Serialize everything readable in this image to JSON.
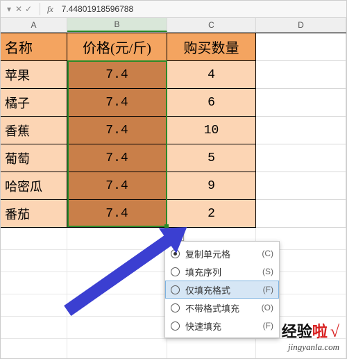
{
  "formula_bar": {
    "fx_label": "fx",
    "value": "7.44801918596788"
  },
  "col_headers": {
    "A": "A",
    "B": "B",
    "C": "C",
    "D": "D"
  },
  "table": {
    "headers": {
      "name": "名称",
      "price": "价格(元/斤)",
      "qty": "购买数量"
    },
    "rows": [
      {
        "name": "苹果",
        "price": "7.4",
        "qty": "4"
      },
      {
        "name": "橘子",
        "price": "7.4",
        "qty": "6"
      },
      {
        "name": "香蕉",
        "price": "7.4",
        "qty": "10"
      },
      {
        "name": "葡萄",
        "price": "7.4",
        "qty": "5"
      },
      {
        "name": "哈密瓜",
        "price": "7.4",
        "qty": "9"
      },
      {
        "name": "番茄",
        "price": "7.4",
        "qty": "2"
      }
    ]
  },
  "autofill_menu": {
    "items": [
      {
        "label": "复制单元格",
        "shortcut": "(C)",
        "selected": true
      },
      {
        "label": "填充序列",
        "shortcut": "(S)",
        "selected": false
      },
      {
        "label": "仅填充格式",
        "shortcut": "(F)",
        "selected": false,
        "hover": true
      },
      {
        "label": "不带格式填充",
        "shortcut": "(O)",
        "selected": false
      },
      {
        "label": "快速填充",
        "shortcut": "(F)",
        "selected": false
      }
    ]
  },
  "watermark": {
    "text_black": "经验",
    "text_red": "啦",
    "check": "√",
    "url": "jingyanla.com"
  },
  "icons": {
    "smarttag": "autofill-options-icon"
  },
  "colors": {
    "header_bg": "#f4a460",
    "body_bg": "#fcd5b4",
    "sel_bg": "#c97f49",
    "marquee": "#2a8a2a",
    "arrow": "#3b3fd1"
  }
}
